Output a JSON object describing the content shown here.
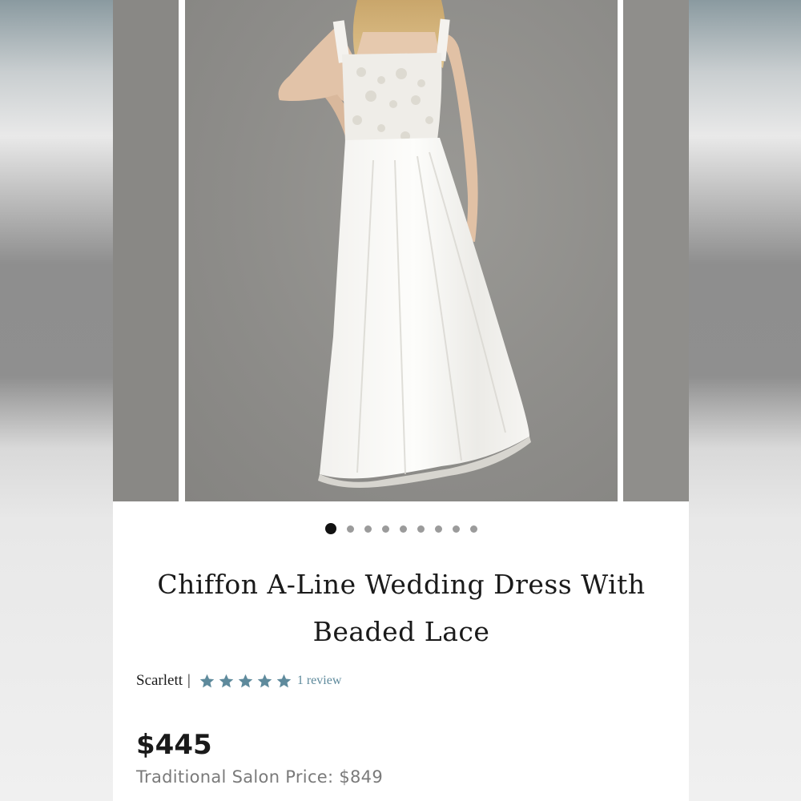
{
  "product": {
    "title_line1": "Chiffon A-Line Wedding Dress With",
    "title_line2": "Beaded Lace",
    "brand": "Scarlett",
    "separator": "|",
    "rating": 5,
    "review_text": "1 review",
    "price": "$445",
    "salon_price": "Traditional Salon Price: $849"
  },
  "gallery": {
    "image_count": 9,
    "active_index": 0,
    "main_image": "model-in-white-chiffon-a-line-gown"
  },
  "colors": {
    "star": "#5e8a9c",
    "review_link": "#5e8a9c",
    "active_dot": "#111111",
    "inactive_dot": "#9b9b9b",
    "photo_background": "#8e8d8a"
  }
}
